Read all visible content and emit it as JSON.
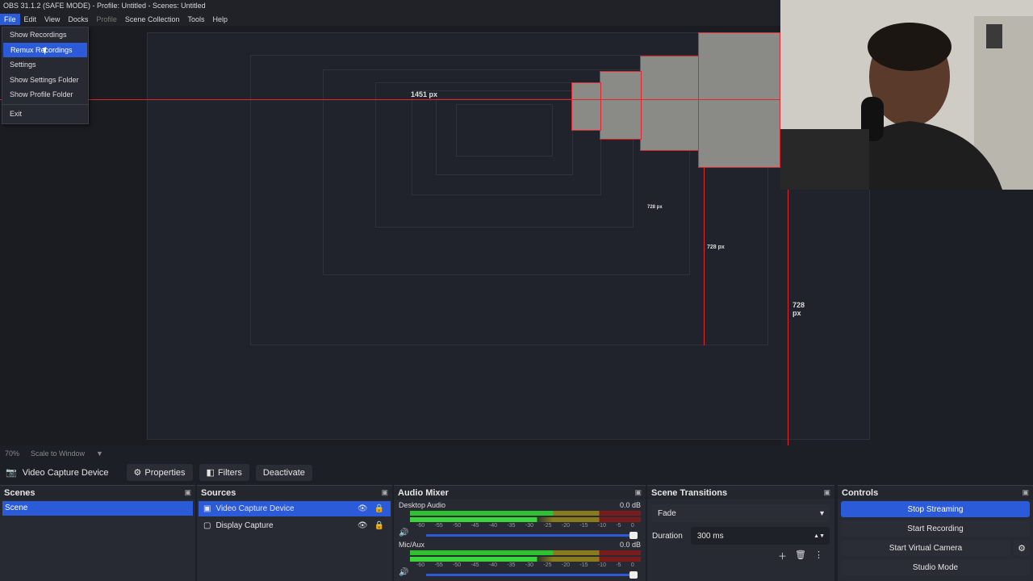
{
  "window": {
    "title": "OBS 31.1.2 (SAFE MODE) - Profile: Untitled - Scenes: Untitled"
  },
  "menu": {
    "items": [
      "File",
      "Edit",
      "View",
      "Docks",
      "Profile",
      "Scene Collection",
      "Tools",
      "Help"
    ]
  },
  "file_menu": {
    "items": [
      "Show Recordings",
      "Remux Recordings",
      "Settings",
      "Show Settings Folder",
      "Show Profile Folder",
      "Exit"
    ],
    "highlighted": "Remux Recordings"
  },
  "preview": {
    "dimension_labels": [
      "1451 px",
      "728 px",
      "728 px",
      "728 px"
    ]
  },
  "statusbar": {
    "zoom": "70%",
    "scale_mode": "Scale to Window"
  },
  "toolbar": {
    "device": "Video Capture Device",
    "properties": "Properties",
    "filters": "Filters",
    "deactivate": "Deactivate"
  },
  "scenes": {
    "title": "Scenes",
    "items": [
      "Scene"
    ]
  },
  "sources": {
    "title": "Sources",
    "items": [
      "Video Capture Device",
      "Display Capture"
    ]
  },
  "audio_mixer": {
    "title": "Audio Mixer",
    "channels": [
      {
        "name": "Desktop Audio",
        "level": "0.0 dB"
      },
      {
        "name": "Mic/Aux",
        "level": "0.0 dB"
      }
    ],
    "ticks": [
      "-60",
      "-55",
      "-50",
      "-45",
      "-40",
      "-35",
      "-30",
      "-25",
      "-20",
      "-15",
      "-10",
      "-5",
      "0"
    ]
  },
  "scene_transitions": {
    "title": "Scene Transitions",
    "transition": "Fade",
    "duration_label": "Duration",
    "duration": "300 ms"
  },
  "controls": {
    "title": "Controls",
    "buttons": [
      "Stop Streaming",
      "Start Recording",
      "Start Virtual Camera",
      "Studio Mode"
    ]
  },
  "colors": {
    "accent": "#2b5bd9",
    "background": "#1d1f26",
    "panel": "#272a33",
    "record_red": "#e0262c"
  }
}
